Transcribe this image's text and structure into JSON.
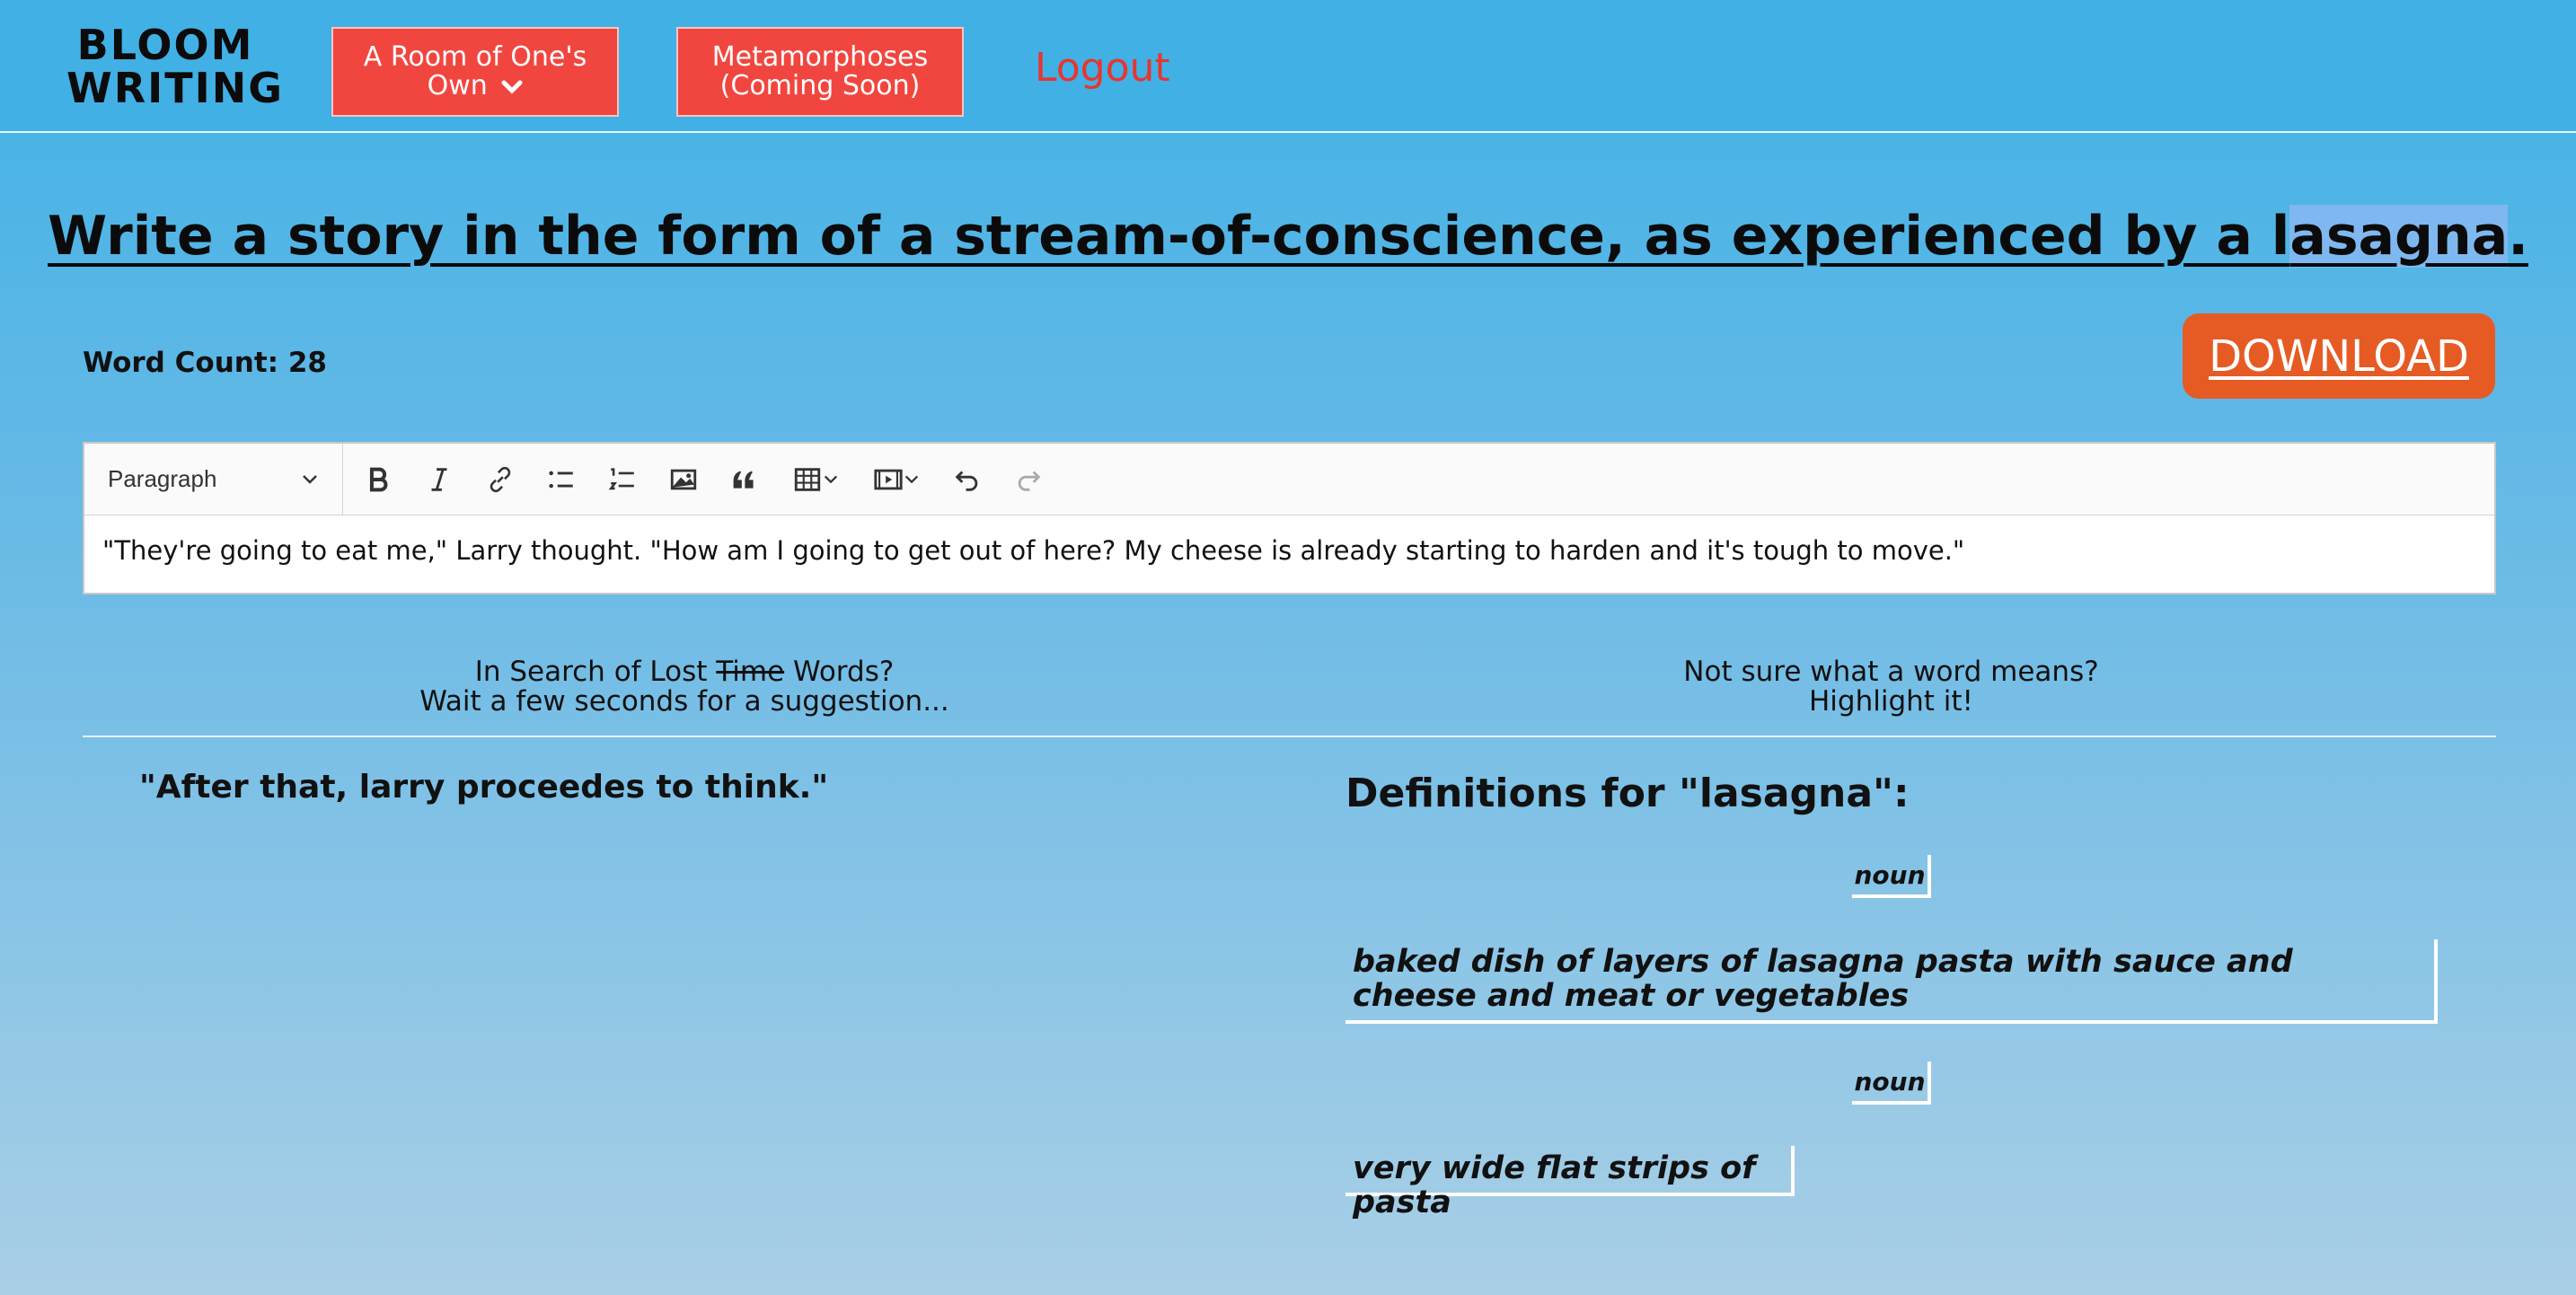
{
  "nav": {
    "logo_line1": "BLOOM",
    "logo_line2": "WRITING",
    "button1_line1": "A Room of One's",
    "button1_line2": "Own",
    "button2_line1": "Metamorphoses",
    "button2_line2": "(Coming Soon)",
    "logout": "Logout"
  },
  "prompt": {
    "text_before": "Write a story in the form of a stream-of-conscience, as experienced by a l",
    "highlighted": "asagna",
    "text_after": "."
  },
  "word_count_label": "Word Count: 28",
  "download_label": "DOWNLOAD",
  "editor": {
    "block_format": "Paragraph",
    "content": "\"They're going to eat me,\" Larry thought. \"How am I going to get out of here? My cheese is already starting to harden and it's tough to move.\""
  },
  "toolbar_icons": [
    "bold-icon",
    "italic-icon",
    "link-icon",
    "bulleted-list-icon",
    "numbered-list-icon",
    "image-icon",
    "quote-icon",
    "table-icon",
    "media-icon",
    "undo-icon",
    "redo-icon"
  ],
  "suggestions": {
    "hint_line1_before": "In Search of Lost ",
    "hint_line1_strike": "Time",
    "hint_line1_after": " Words?",
    "hint_line2": "Wait a few seconds for a suggestion...",
    "suggestion_text": "\"After that, larry proceedes to think.\""
  },
  "definitions": {
    "hint_line1": "Not sure what a word means?",
    "hint_line2": "Highlight it!",
    "title": "Definitions for \"lasagna\":",
    "entries": [
      {
        "pos": "noun",
        "text": "baked dish of layers of lasagna pasta with sauce and cheese and meat or vegetables"
      },
      {
        "pos": "noun",
        "text": "very wide flat strips of pasta"
      }
    ]
  },
  "colors": {
    "nav_bg": "#41b0e5",
    "nav_button": "#f1463f",
    "logout": "#e8352f",
    "download": "#e65b24",
    "highlight": "#7fb8f0"
  }
}
